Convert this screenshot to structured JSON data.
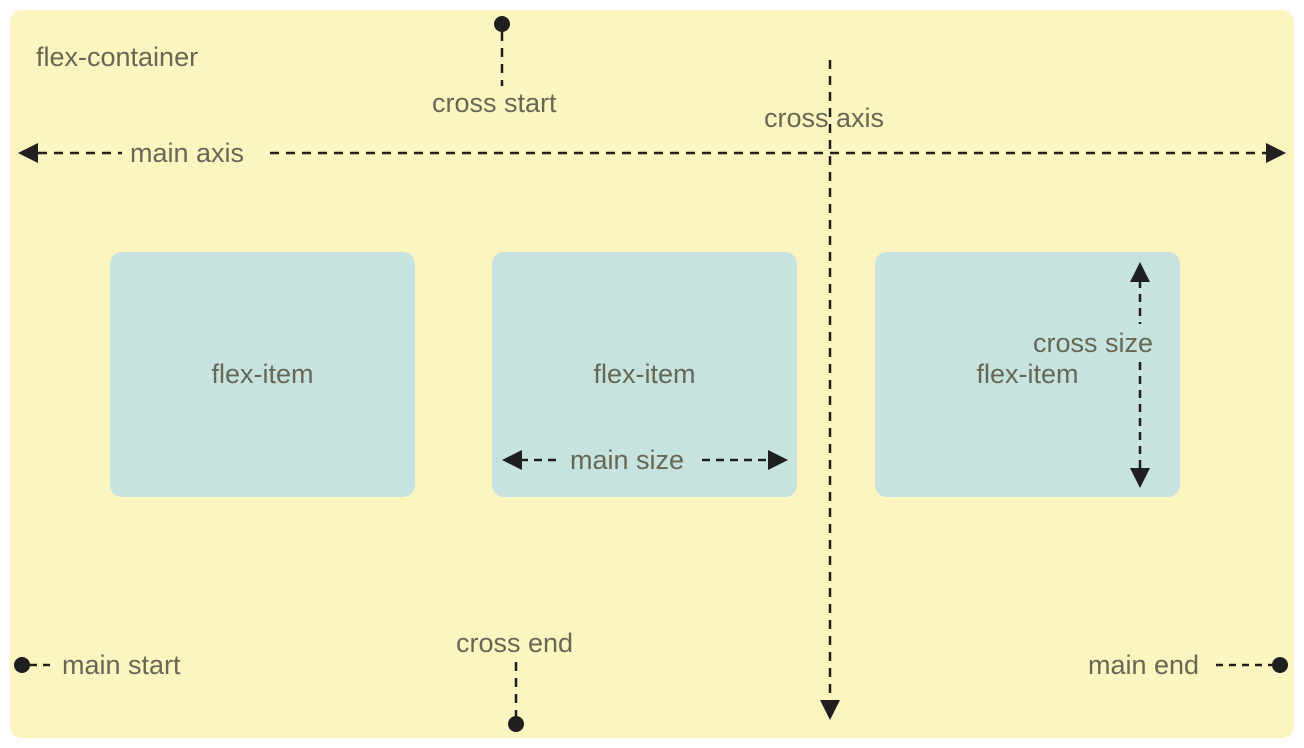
{
  "labels": {
    "container": "flex-container",
    "item": "flex-item",
    "main_axis": "main axis",
    "cross_axis": "cross axis",
    "cross_start": "cross start",
    "cross_end": "cross end",
    "main_start": "main start",
    "main_end": "main end",
    "main_size": "main size",
    "cross_size": "cross size"
  },
  "colors": {
    "container_bg": "#fdf5c0",
    "item_bg": "#c6e3e0",
    "line": "#1f1f1f",
    "text": "#676755"
  }
}
